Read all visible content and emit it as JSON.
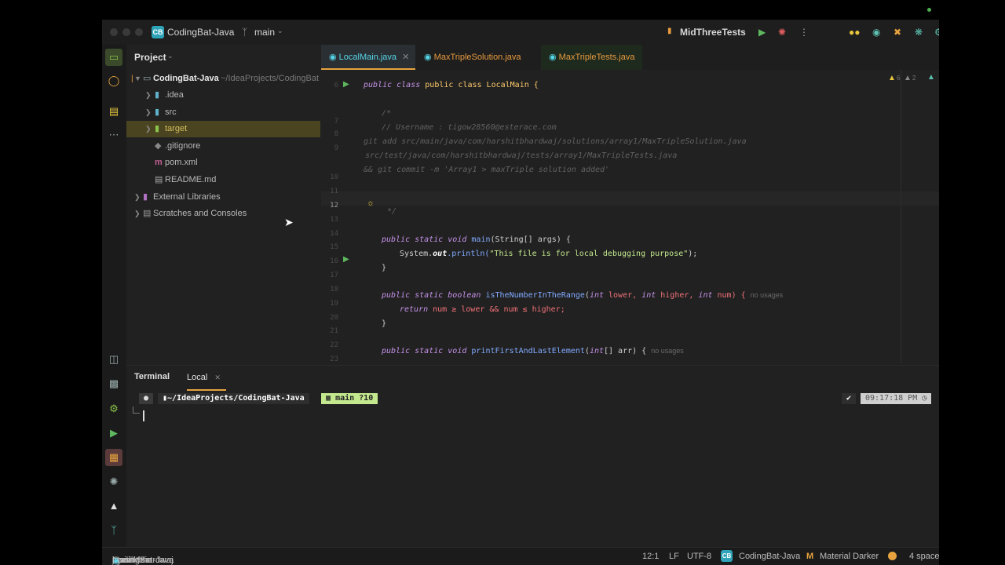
{
  "titlebar": {
    "project_badge": "CB",
    "project_name": "CodingBat-Java",
    "branch": "main",
    "run_config": "MidThreeTests"
  },
  "project_panel": {
    "title": "Project",
    "root_name": "CodingBat-Java",
    "root_path": "~/IdeaProjects/CodingBat",
    "items": [
      {
        "label": ".idea"
      },
      {
        "label": "src"
      },
      {
        "label": "target"
      },
      {
        "label": ".gitignore"
      },
      {
        "label": "pom.xml"
      },
      {
        "label": "README.md"
      },
      {
        "label": "External Libraries"
      },
      {
        "label": "Scratches and Consoles"
      }
    ]
  },
  "tabs": [
    {
      "label": "LocalMain.java"
    },
    {
      "label": "MaxTripleSolution.java"
    },
    {
      "label": "MaxTripleTests.java"
    }
  ],
  "editor": {
    "inspections": {
      "warnings": "6",
      "weak": "2"
    },
    "line_numbers": [
      "6",
      "6",
      "7",
      "8",
      "9",
      "",
      "10",
      "11",
      "12",
      "13",
      "14",
      "15",
      "16",
      "17",
      "18",
      "19",
      "20",
      "21",
      "22",
      "23"
    ],
    "lines": {
      "l1": "public class LocalMain {",
      "l2": "/*",
      "l3": "// Username : tigow28560@esterace.com",
      "l4": "git add src/main/java/com/harshitbhardwaj/solutions/array1/MaxTripleSolution.java",
      "l5": "src/test/java/com/harshitbhardwaj/tests/array1/MaxTripleTests.java",
      "l6": "&& git commit -m 'Array1 > maxTriple solution added'",
      "l7": "*/",
      "l8_kw": "public static void",
      "l8_fn": "main",
      "l8_rest": "(String[] args) {",
      "l9_a": "System.",
      "l9_b": "out",
      "l9_c": ".println(",
      "l9_str": "\"This file is for local debugging purpose\"",
      "l9_d": ");",
      "l10": "}",
      "l11_kw": "public static boolean",
      "l11_fn": "isTheNumberInTheRange",
      "l11_p1": "(",
      "l11_int1": "int",
      "l11_p2": " lower, ",
      "l11_int2": "int",
      "l11_p3": " higher, ",
      "l11_int3": "int",
      "l11_p4": " num) {",
      "l11_hint": "no usages",
      "l12_kw": "return",
      "l12_rest": " num ≥ lower && num ≤ higher;",
      "l13": "}",
      "l14_kw": "public static void",
      "l14_fn": "printFirstAndLastElement",
      "l14_p1": "(",
      "l14_int": "int",
      "l14_p2": "[] arr) {",
      "l14_hint": "no usages"
    }
  },
  "terminal": {
    "title": "Terminal",
    "tab": "Local",
    "path": "~/IdeaProjects/CodingBat-Java",
    "branch": "main ?10",
    "check": "✔",
    "time": "09:17:18 PM"
  },
  "statusbar": {
    "crumbs": [
      "CodingBat-Java",
      "src",
      "main",
      "java",
      "com",
      "harshitbhardwaj",
      "LocalMain"
    ],
    "position": "12:1",
    "line_sep": "LF",
    "encoding": "UTF-8",
    "project_badge": "CB",
    "project": "CodingBat-Java",
    "theme": "Material Darker",
    "indent": "4 space"
  },
  "colors": {
    "accent": "#e7a33e",
    "tab_text": "#56d6e8",
    "tab_text_alt": "#e79a3e"
  }
}
